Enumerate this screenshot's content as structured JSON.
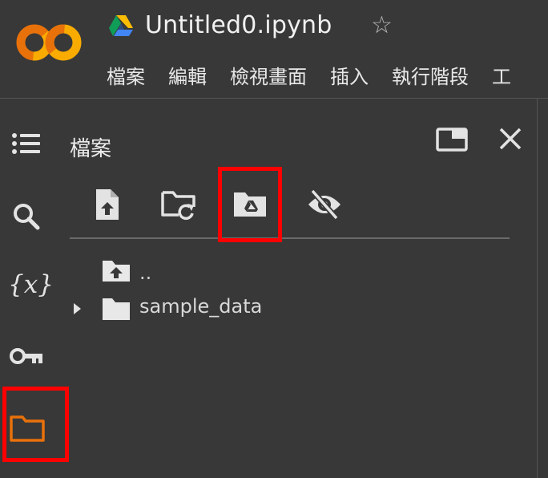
{
  "header": {
    "logo_icon": "colab-logo",
    "drive_badge_icon": "google-drive-icon",
    "title": "Untitled0.ipynb",
    "star_icon": "star-icon",
    "menu": [
      "檔案",
      "編輯",
      "檢視畫面",
      "插入",
      "執行階段",
      "工"
    ]
  },
  "sidebar": {
    "items": [
      {
        "icon": "table-of-contents-icon"
      },
      {
        "icon": "search-icon"
      },
      {
        "icon": "variables-icon",
        "label": "{x}"
      },
      {
        "icon": "key-icon"
      },
      {
        "icon": "folder-icon"
      }
    ],
    "active_color": "#e8710a"
  },
  "files_panel": {
    "title": "檔案",
    "maximize_icon": "maximize-panel-icon",
    "close_icon": "close-icon",
    "toolbar": [
      "upload-file-icon",
      "refresh-folder-icon",
      "mount-drive-icon",
      "hide-hidden-files-icon"
    ],
    "tree": [
      {
        "icon": "parent-folder-icon",
        "label": ".."
      },
      {
        "icon": "folder-icon",
        "label": "sample_data",
        "expandable": true
      }
    ]
  },
  "highlight_color": "#ff0000"
}
